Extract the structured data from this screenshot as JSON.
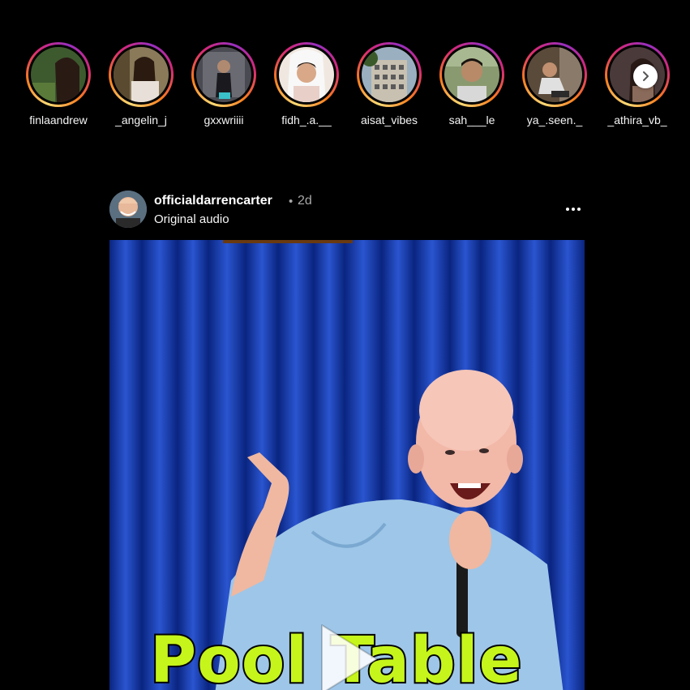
{
  "stories": [
    {
      "username": "finlaandrew",
      "avatar_color": "#4a5a3a"
    },
    {
      "username": "_angelin_j",
      "avatar_color": "#b59b7a"
    },
    {
      "username": "gxxwriiii",
      "avatar_color": "#6b6b78"
    },
    {
      "username": "fidh_.a.__",
      "avatar_color": "#e8d8c8"
    },
    {
      "username": "aisat_vibes",
      "avatar_color": "#7a8a9a"
    },
    {
      "username": "sah___le",
      "avatar_color": "#8a9a6a"
    },
    {
      "username": "ya_.seen._",
      "avatar_color": "#6a5a4a"
    },
    {
      "username": "_athira_vb_",
      "avatar_color": "#5a4a4a"
    }
  ],
  "post": {
    "username": "officialdarrencarter",
    "separator": "•",
    "time": "2d",
    "audio": "Original audio",
    "caption_overlay": "Pool Table"
  },
  "colors": {
    "story_ring": "#d62976",
    "caption_fill": "#c6f51b",
    "curtain": "#1a3fb0"
  },
  "icons": {
    "next": "chevron-right-icon",
    "more": "more-options-icon",
    "play": "play-icon"
  }
}
